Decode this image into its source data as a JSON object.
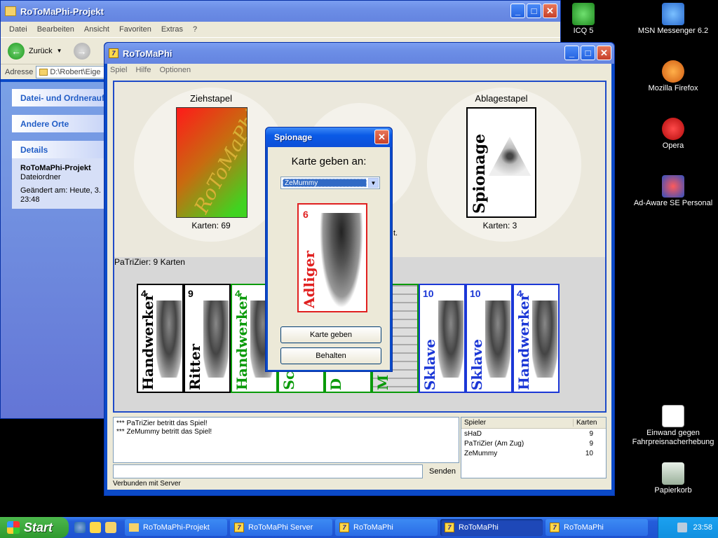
{
  "desktop_icons": [
    {
      "label": "ICQ 5",
      "icon": "icq-icon",
      "color": "#2ec72e"
    },
    {
      "label": "MSN Messenger 6.2",
      "icon": "msn-messenger-icon",
      "color": "#3a7bd5"
    },
    {
      "label": "Mozilla Firefox",
      "icon": "firefox-icon",
      "color": "#e6761a"
    },
    {
      "label": "Opera",
      "icon": "opera-icon",
      "color": "#d0181a"
    },
    {
      "label": "Ad-Aware SE Personal",
      "icon": "ad-aware-icon",
      "color": "#3050c0"
    },
    {
      "label": "Einwand gegen Fahrpreisnacherhebung",
      "icon": "word-document-icon",
      "color": "#2a5bd7"
    },
    {
      "label": "Papierkorb",
      "icon": "recycle-bin-icon",
      "color": "#5a9a5a"
    }
  ],
  "explorer": {
    "title": "RoToMaPhi-Projekt",
    "menu": [
      "Datei",
      "Bearbeiten",
      "Ansicht",
      "Favoriten",
      "Extras",
      "?"
    ],
    "back_label": "Zurück",
    "address_label": "Adresse",
    "address_value": "D:\\Robert\\Eige",
    "tasks": [
      "Datei- und Ordneraufg",
      "Andere Orte",
      "Details"
    ],
    "details": {
      "name": "RoToMaPhi-Projekt",
      "type": "Dateiordner",
      "modified": "Geändert am: Heute, 3.",
      "time": "23:48"
    }
  },
  "game": {
    "title": "RoToMaPhi",
    "menu": [
      "Spiel",
      "Hilfe",
      "Optionen"
    ],
    "draw_pile": {
      "label": "Ziehstapel",
      "count_label": "Karten:  69",
      "back_text": "RoToMaPhi"
    },
    "discard_pile": {
      "label": "Ablagestapel",
      "count_label": "Karten:  3",
      "top_card": "Spionage"
    },
    "hidden_text": "t.",
    "player_label": "PaTriZier: 9 Karten",
    "hand": [
      {
        "name": "Handwerker",
        "num": "4",
        "color": "black"
      },
      {
        "name": "Ritter",
        "num": "9",
        "color": "black"
      },
      {
        "name": "Handwerker",
        "num": "4",
        "color": "green"
      },
      {
        "name": "Sc",
        "num": "",
        "color": "green"
      },
      {
        "name": "D",
        "num": "",
        "color": "green"
      },
      {
        "name": "M",
        "num": "",
        "color": "green"
      },
      {
        "name": "Sklave",
        "num": "10",
        "color": "blue"
      },
      {
        "name": "Sklave",
        "num": "10",
        "color": "blue"
      },
      {
        "name": "Handwerker",
        "num": "4",
        "color": "blue"
      }
    ],
    "chat_lines": [
      "*** PaTriZier betritt das Spiel!",
      "*** ZeMummy betritt das Spiel!"
    ],
    "chat_input": "",
    "send_label": "Senden",
    "players_header": {
      "name": "Spieler",
      "cards": "Karten"
    },
    "players": [
      {
        "name": "sHaD",
        "cards": "9"
      },
      {
        "name": "PaTriZier (Am Zug)",
        "cards": "9"
      },
      {
        "name": "ZeMummy",
        "cards": "10"
      }
    ],
    "status": "Verbunden mit Server"
  },
  "dialog": {
    "title": "Spionage",
    "question": "Karte geben an:",
    "selected_player": "ZeMummy",
    "card": {
      "name": "Adliger",
      "num": "6"
    },
    "give_label": "Karte geben",
    "keep_label": "Behalten"
  },
  "taskbar": {
    "start_label": "Start",
    "buttons": [
      {
        "label": "RoToMaPhi-Projekt",
        "active": false
      },
      {
        "label": "RoToMaPhi Server",
        "active": false
      },
      {
        "label": "RoToMaPhi",
        "active": false
      },
      {
        "label": "RoToMaPhi",
        "active": true
      },
      {
        "label": "RoToMaPhi",
        "active": false
      }
    ],
    "clock": "23:58"
  }
}
